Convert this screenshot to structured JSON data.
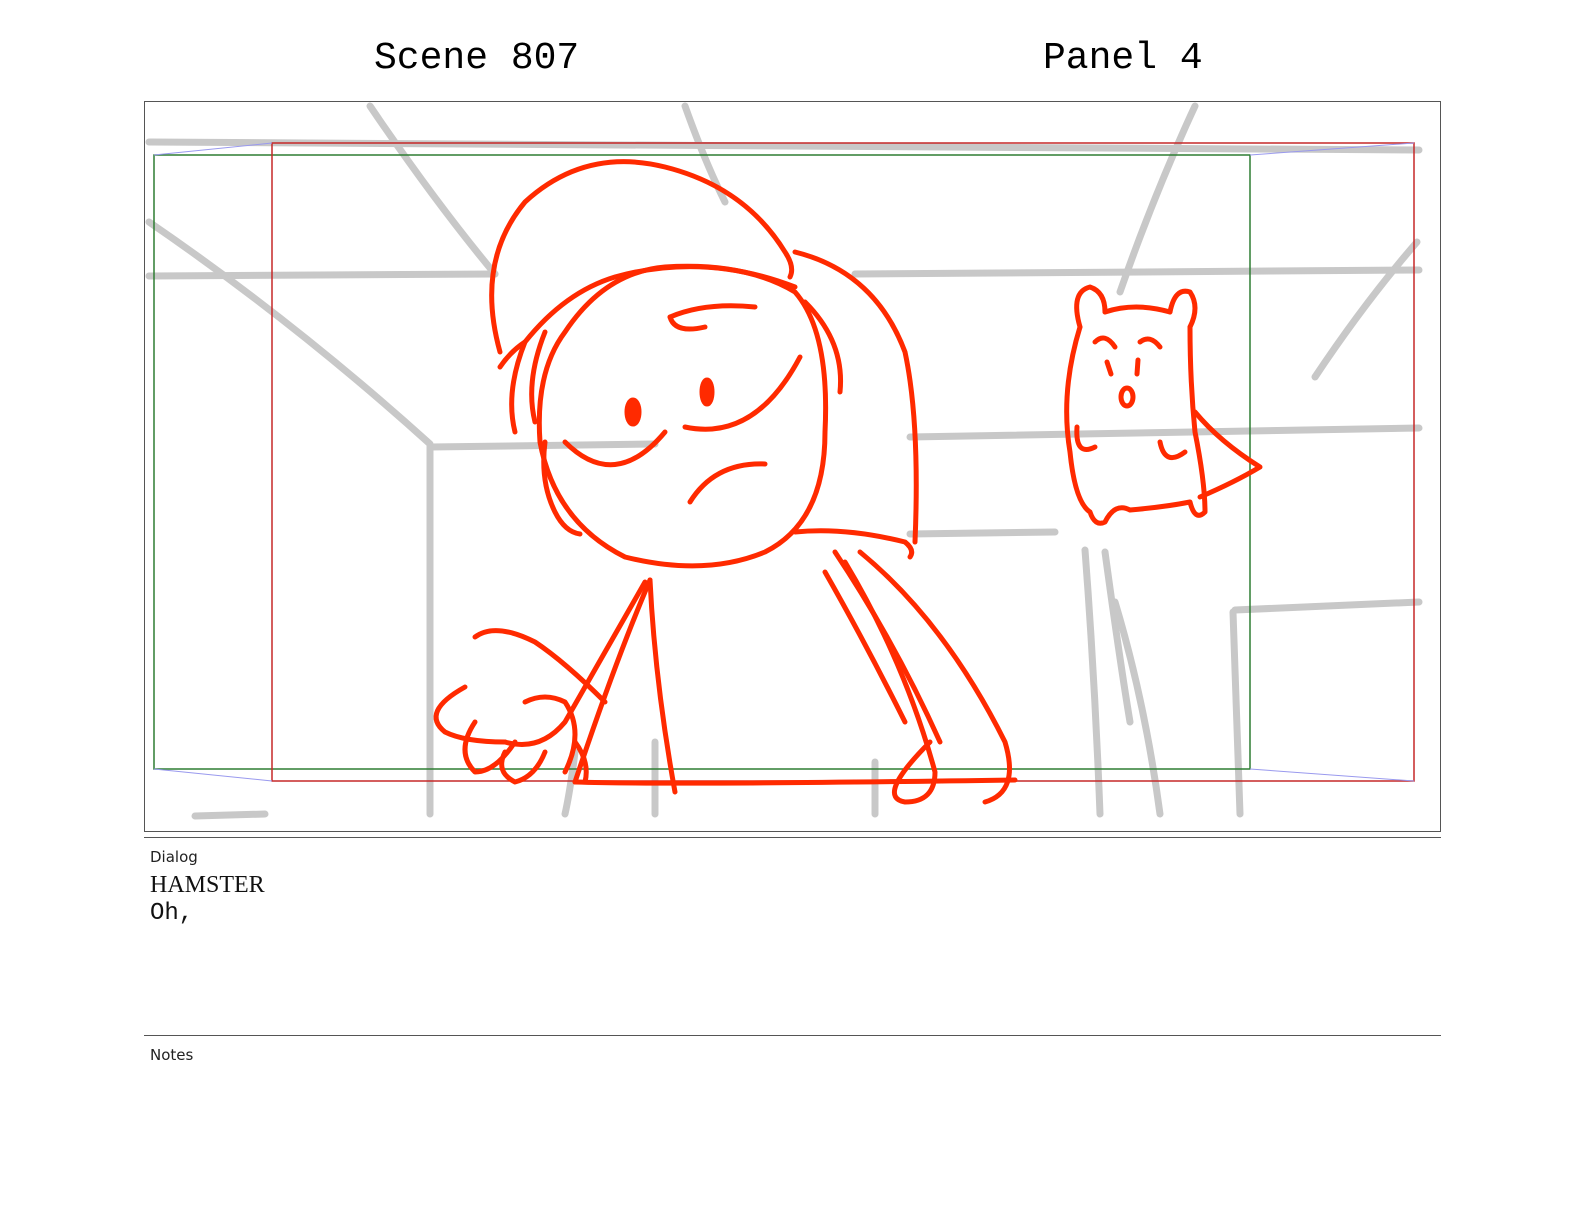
{
  "header": {
    "scene": "Scene 807",
    "panel": "Panel 4"
  },
  "dialog": {
    "label": "Dialog",
    "character": "HAMSTER",
    "line": "Oh,"
  },
  "notes": {
    "label": "Notes",
    "text": ""
  },
  "colors": {
    "sketch_red": "#ff2a00",
    "background_lines": "#c8c8c8",
    "safe_frame_green": "#2e7d32",
    "camera_frame_red": "#c62828",
    "camera_arrow": "#9999ee"
  }
}
